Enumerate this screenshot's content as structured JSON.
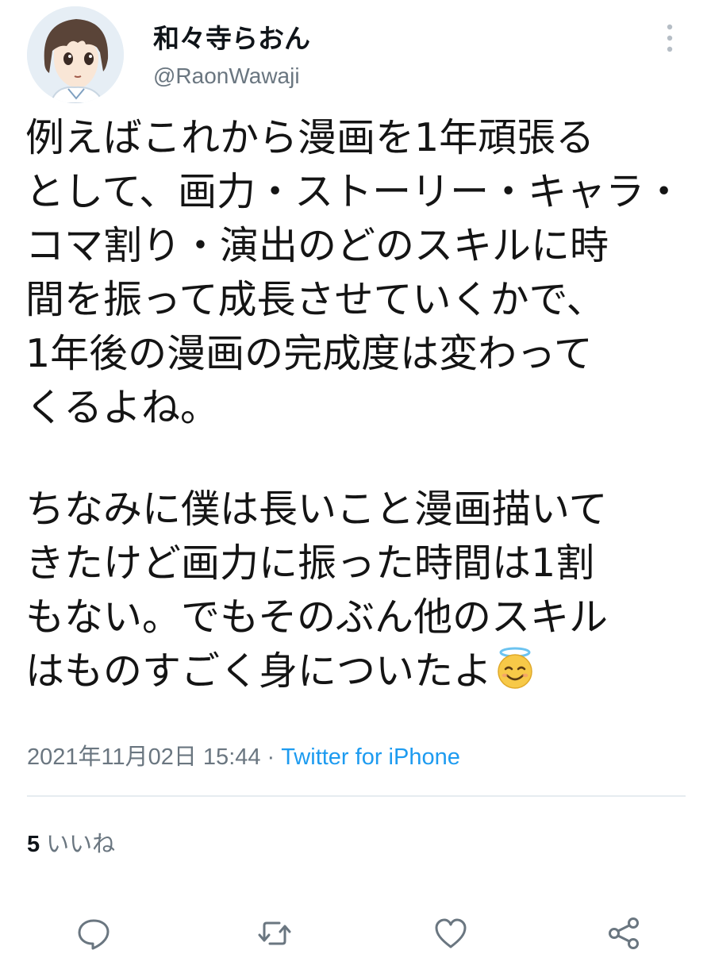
{
  "author": {
    "display_name": "和々寺らおん",
    "handle": "@RaonWawaji",
    "avatar_icon": "anime-girl-avatar-icon"
  },
  "tweet": {
    "paragraphs": [
      {
        "lines": [
          "例えばこれから漫画を1年頑張る",
          "として、画力・ストーリー・キャラ・",
          "コマ割り・演出のどのスキルに時",
          "間を振って成長させていくかで、",
          "1年後の漫画の完成度は変わって",
          "くるよね。"
        ]
      },
      {
        "lines": [
          "ちなみに僕は長いこと漫画描いて",
          "きたけど画力に振った時間は1割",
          "もない。でもそのぶん他のスキル",
          "はものすごく身についたよ"
        ],
        "trailing_emoji": "smiling-face-with-halo-icon"
      }
    ],
    "timestamp": "2021年11月02日 15:44",
    "separator": "·",
    "source": "Twitter for iPhone"
  },
  "stats": {
    "likes_count": "5",
    "likes_label": "いいね"
  },
  "actions": [
    {
      "name": "reply-icon"
    },
    {
      "name": "retweet-icon"
    },
    {
      "name": "like-icon"
    },
    {
      "name": "share-icon"
    }
  ],
  "colors": {
    "text": "#0f1419",
    "secondary": "#6a7680",
    "link": "#1d9bf0",
    "divider": "#e6ecf0"
  }
}
